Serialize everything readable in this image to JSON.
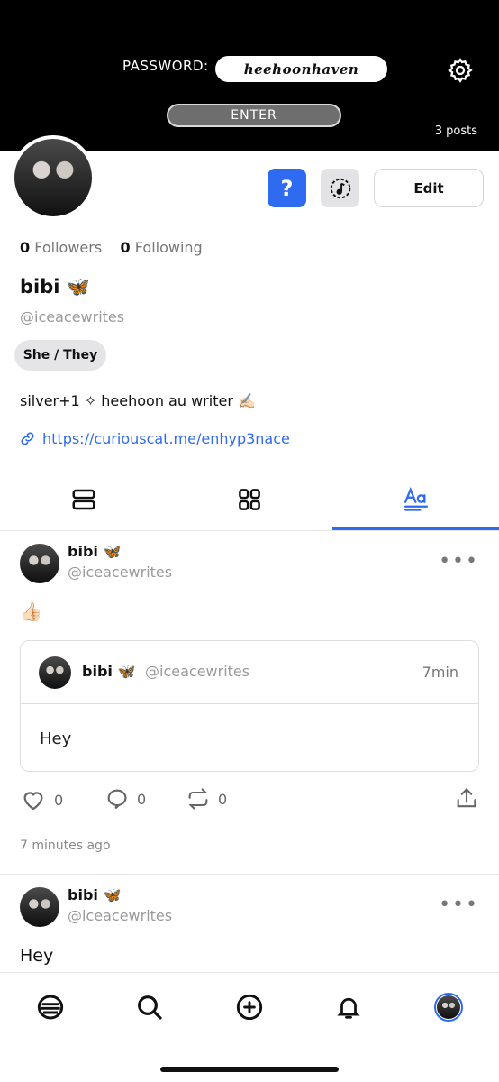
{
  "banner": {
    "password_label": "PASSWORD:",
    "password_value": "heehoonhaven",
    "enter_label": "ENTER",
    "posts_count": "3 posts"
  },
  "profile": {
    "followers_count": "0",
    "followers_label": "Followers",
    "following_count": "0",
    "following_label": "Following",
    "name": "bibi 🦋",
    "handle": "@iceacewrites",
    "pronouns": "She / They",
    "bio": "silver+1 ✧ heehoon au writer ✍🏻",
    "link": "https://curiouscat.me/enhyp3nace",
    "edit_label": "Edit",
    "question_label": "?"
  },
  "tabs": [
    "posts-list",
    "media-grid",
    "text-posts"
  ],
  "posts": [
    {
      "name": "bibi 🦋",
      "handle": "@iceacewrites",
      "body": "👍🏻",
      "quote": {
        "name": "bibi 🦋",
        "handle": "@iceacewrites",
        "time": "7min",
        "body": "Hey"
      },
      "likes": "0",
      "comments": "0",
      "reposts": "0",
      "time_ago": "7 minutes ago"
    },
    {
      "name": "bibi 🦋",
      "handle": "@iceacewrites",
      "body": "Hey"
    }
  ],
  "colors": {
    "accent": "#2f6bf0",
    "banner_bg": "#000000"
  }
}
